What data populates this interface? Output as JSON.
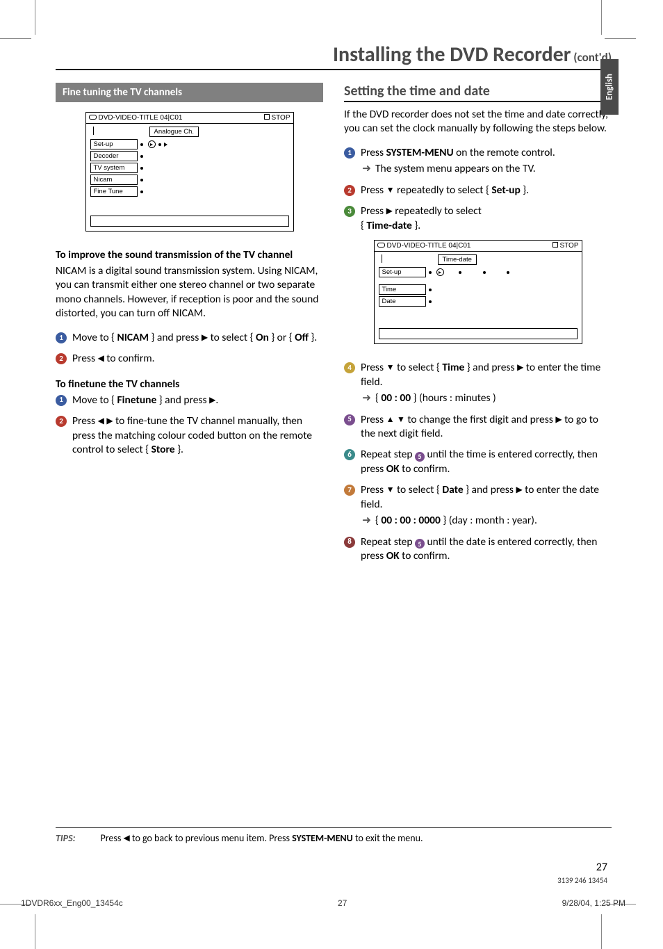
{
  "lang_tab": "English",
  "title": {
    "main": "Installing the DVD Recorder",
    "contd": " (cont'd)"
  },
  "left": {
    "section_bar": "Fine tuning the TV channels",
    "osd1": {
      "status_left": "DVD-VIDEO-TITLE 04|C01",
      "status_right": "STOP",
      "crumb": "Analogue Ch.",
      "items": [
        "Set-up",
        "Decoder",
        "TV system",
        "Nicam",
        "Fine Tune"
      ]
    },
    "sub1": "To improve the sound transmission of the TV channel",
    "para1": "NICAM is a digital sound transmission system.  Using NICAM, you can transmit either one stereo channel or two separate mono channels.  However, if reception is poor and the sound distorted, you can turn off NICAM.",
    "nicam_step_a_pre": "Move to { ",
    "nicam_step_a_bold": "NICAM",
    "nicam_step_a_mid": " } and press ",
    "nicam_step_a_post": " to select { ",
    "nicam_step_a_on": "On",
    "nicam_step_a_or": " } or { ",
    "nicam_step_a_off": "Off",
    "nicam_step_a_end": " }.",
    "nicam_step_b_pre": "Press ",
    "nicam_step_b_post": " to confirm.",
    "sub2": "To finetune the TV channels",
    "ft_step_a_pre": "Move to { ",
    "ft_step_a_bold": "Finetune",
    "ft_step_a_mid": " } and press ",
    "ft_step_a_end": ".",
    "ft_step_b_pre": "Press ",
    "ft_step_b_post": " to fine-tune the TV channel manually, then press the matching colour coded button on the remote control to select { ",
    "ft_step_b_bold": "Store",
    "ft_step_b_end": " }."
  },
  "right": {
    "heading": "Setting the time and date",
    "intro": "If the DVD recorder does not set the time and date correctly, you can set the clock manually by following the steps below.",
    "s1_pre": "Press ",
    "s1_bold": "SYSTEM-MENU",
    "s1_post": " on the remote control.",
    "s1_arrow": "The system menu appears on the TV.",
    "s2_pre": "Press ",
    "s2_mid": " repeatedly to select { ",
    "s2_bold": "Set-up",
    "s2_end": " }.",
    "s3_pre": "Press ",
    "s3_mid": " repeatedly to select",
    "s3_line2_pre": "{ ",
    "s3_line2_bold": "Time-date",
    "s3_line2_end": " }.",
    "osd2": {
      "status_left": "DVD-VIDEO-TITLE 04|C01",
      "status_right": "STOP",
      "crumb": "Time-date",
      "items": [
        "Set-up",
        "Time",
        "Date"
      ]
    },
    "s4_pre": "Press ",
    "s4_mid": " to select { ",
    "s4_bold": "Time",
    "s4_mid2": " } and press ",
    "s4_post": " to enter the time field.",
    "s4_arrow_pre": "{ ",
    "s4_arrow_bold": "00 : 00",
    "s4_arrow_post": " } (hours : minutes )",
    "s5_pre": "Press ",
    "s5_mid": " to change the first digit and press ",
    "s5_post": " to go to the next digit field.",
    "s6_pre": "Repeat step ",
    "s6_post": " until the time is entered correctly, then press ",
    "s6_bold": "OK",
    "s6_end": " to confirm.",
    "s7_pre": "Press ",
    "s7_mid": " to select { ",
    "s7_bold": "Date",
    "s7_mid2": " } and press ",
    "s7_post": " to enter the date field.",
    "s7_arrow_pre": "{ ",
    "s7_arrow_bold": "00 : 00 : 0000",
    "s7_arrow_post": " } (day : month : year).",
    "s8_pre": "Repeat step ",
    "s8_post": " until the date is entered correctly, then press ",
    "s8_bold": "OK",
    "s8_end": " to confirm."
  },
  "tips": {
    "label": "TIPS:",
    "text_pre": "Press ",
    "text_mid": " to go back to previous menu item.  Press ",
    "text_bold": "SYSTEM-MENU",
    "text_end": " to exit the menu."
  },
  "pagenum": "27",
  "partnum": "3139 246 13454",
  "footer": {
    "left": "1DVDR6xx_Eng00_13454c",
    "mid": "27",
    "right": "9/28/04, 1:25 PM"
  },
  "glyph": {
    "left": "◀",
    "right": "▶",
    "up": "▲",
    "down": "▼",
    "arrow": "➜"
  }
}
